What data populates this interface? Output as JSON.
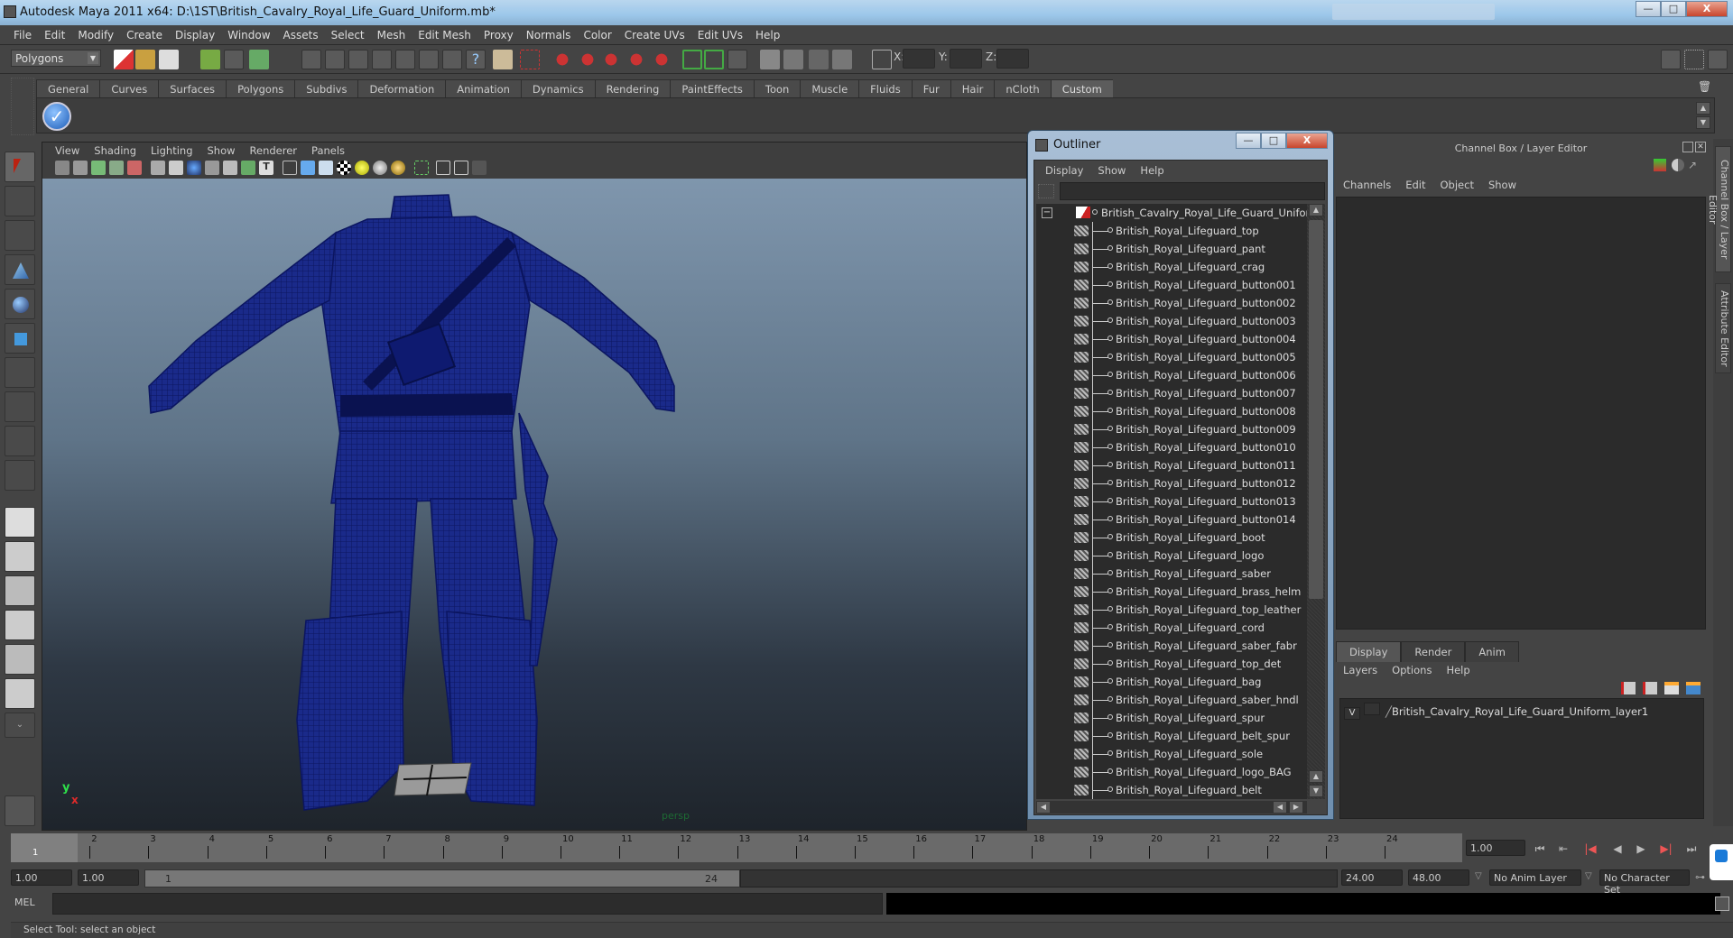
{
  "window": {
    "title": "Autodesk Maya 2011 x64: D:\\1ST\\British_Cavalry_Royal_Life_Guard_Uniform.mb*",
    "min_label": "—",
    "max_label": "□",
    "close_label": "X"
  },
  "menubar": [
    "File",
    "Edit",
    "Modify",
    "Create",
    "Display",
    "Window",
    "Assets",
    "Select",
    "Mesh",
    "Edit Mesh",
    "Proxy",
    "Normals",
    "Color",
    "Create UVs",
    "Edit UVs",
    "Help"
  ],
  "statusline": {
    "mode": "Polygons",
    "x_label": "X:",
    "y_label": "Y:",
    "z_label": "Z:"
  },
  "shelf": {
    "tabs": [
      "General",
      "Curves",
      "Surfaces",
      "Polygons",
      "Subdivs",
      "Deformation",
      "Animation",
      "Dynamics",
      "Rendering",
      "PaintEffects",
      "Toon",
      "Muscle",
      "Fluids",
      "Fur",
      "Hair",
      "nCloth",
      "Custom"
    ],
    "active_tab": "Custom",
    "check_glyph": "✓"
  },
  "viewport": {
    "menu": [
      "View",
      "Shading",
      "Lighting",
      "Show",
      "Renderer",
      "Panels"
    ],
    "camera": "persp",
    "axis_y": "y",
    "axis_x": "x",
    "wire_color": "#10208a"
  },
  "outliner": {
    "title": "Outliner",
    "menu": [
      "Display",
      "Show",
      "Help"
    ],
    "search_value": "",
    "root": "British_Cavalry_Royal_Life_Guard_Uniform",
    "collapse_glyph": "−",
    "items": [
      "British_Royal_Lifeguard_top",
      "British_Royal_Lifeguard_pant",
      "British_Royal_Lifeguard_crag",
      "British_Royal_Lifeguard_button001",
      "British_Royal_Lifeguard_button002",
      "British_Royal_Lifeguard_button003",
      "British_Royal_Lifeguard_button004",
      "British_Royal_Lifeguard_button005",
      "British_Royal_Lifeguard_button006",
      "British_Royal_Lifeguard_button007",
      "British_Royal_Lifeguard_button008",
      "British_Royal_Lifeguard_button009",
      "British_Royal_Lifeguard_button010",
      "British_Royal_Lifeguard_button011",
      "British_Royal_Lifeguard_button012",
      "British_Royal_Lifeguard_button013",
      "British_Royal_Lifeguard_button014",
      "British_Royal_Lifeguard_boot",
      "British_Royal_Lifeguard_logo",
      "British_Royal_Lifeguard_saber",
      "British_Royal_Lifeguard_brass_helm",
      "British_Royal_Lifeguard_top_leather",
      "British_Royal_Lifeguard_cord",
      "British_Royal_Lifeguard_saber_fabr",
      "British_Royal_Lifeguard_top_det",
      "British_Royal_Lifeguard_bag",
      "British_Royal_Lifeguard_saber_hndl",
      "British_Royal_Lifeguard_spur",
      "British_Royal_Lifeguard_belt_spur",
      "British_Royal_Lifeguard_sole",
      "British_Royal_Lifeguard_logo_BAG",
      "British_Royal_Lifeguard_belt"
    ]
  },
  "channel_box": {
    "header": "Channel Box / Layer Editor",
    "menu": [
      "Channels",
      "Edit",
      "Object",
      "Show"
    ],
    "layer_tabs": [
      "Display",
      "Render",
      "Anim"
    ],
    "active_layer_tab": "Display",
    "layer_menu": [
      "Layers",
      "Options",
      "Help"
    ],
    "layers": [
      {
        "visible": "V",
        "name": "British_Cavalry_Royal_Life_Guard_Uniform_layer1"
      }
    ]
  },
  "side_tabs": [
    "Channel Box / Layer Editor",
    "Attribute Editor"
  ],
  "timeline": {
    "ticks": [
      "1",
      "2",
      "3",
      "4",
      "5",
      "6",
      "7",
      "8",
      "9",
      "10",
      "11",
      "12",
      "13",
      "14",
      "15",
      "16",
      "17",
      "18",
      "19",
      "20",
      "21",
      "22",
      "23",
      "24"
    ],
    "current_frame_marker": "1",
    "current_time": "1.00"
  },
  "range": {
    "start_time": "1.00",
    "playback_start": "1.00",
    "range_start": "1",
    "range_end": "24",
    "playback_end": "24.00",
    "end_time": "48.00",
    "anim_layer": "No Anim Layer",
    "character_set": "No Character Set"
  },
  "playback": [
    "⏮",
    "⇤",
    "|◀",
    "◀",
    "▶",
    "▶|",
    "⏭"
  ],
  "commandline": {
    "label": "MEL",
    "value": ""
  },
  "helpline": "Select Tool: select an object"
}
